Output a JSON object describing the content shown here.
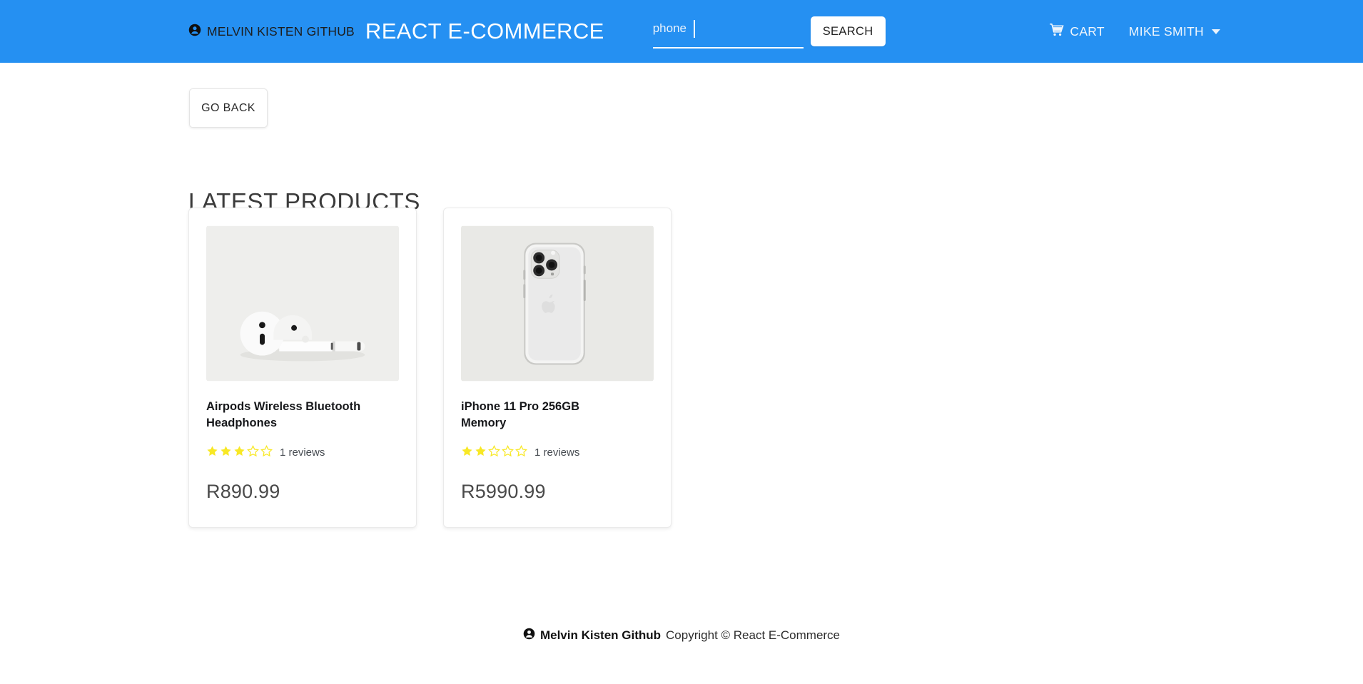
{
  "navbar": {
    "background_color": "#2590f2",
    "owner_icon": "person-circle-icon",
    "owner_label": "MELVIN KISTEN GITHUB",
    "brand_title": "REACT E-COMMERCE",
    "search": {
      "value": "phone",
      "placeholder": "",
      "button_label": "SEARCH"
    },
    "cart": {
      "icon": "shopping-cart-icon",
      "label": "CART"
    },
    "user": {
      "label": "MIKE SMITH",
      "caret_icon": "chevron-down-icon"
    }
  },
  "main": {
    "go_back_label": "GO BACK",
    "page_title": "LATEST PRODUCTS",
    "products": [
      {
        "name": "Airpods Wireless Bluetooth Headphones",
        "image": "airpods-product-image",
        "rating": 3,
        "max_rating": 5,
        "reviews_text": "1 reviews",
        "price": "R890.99"
      },
      {
        "name": "iPhone 11 Pro 256GB Memory",
        "image": "iphone-11-pro-product-image",
        "rating": 2,
        "max_rating": 5,
        "reviews_text": "1 reviews",
        "price": "R5990.99"
      }
    ],
    "star_color": "#f8e825"
  },
  "footer": {
    "owner_icon": "person-circle-icon",
    "owner_label": "Melvin Kisten Github",
    "copyright": "Copyright © React E-Commerce"
  }
}
